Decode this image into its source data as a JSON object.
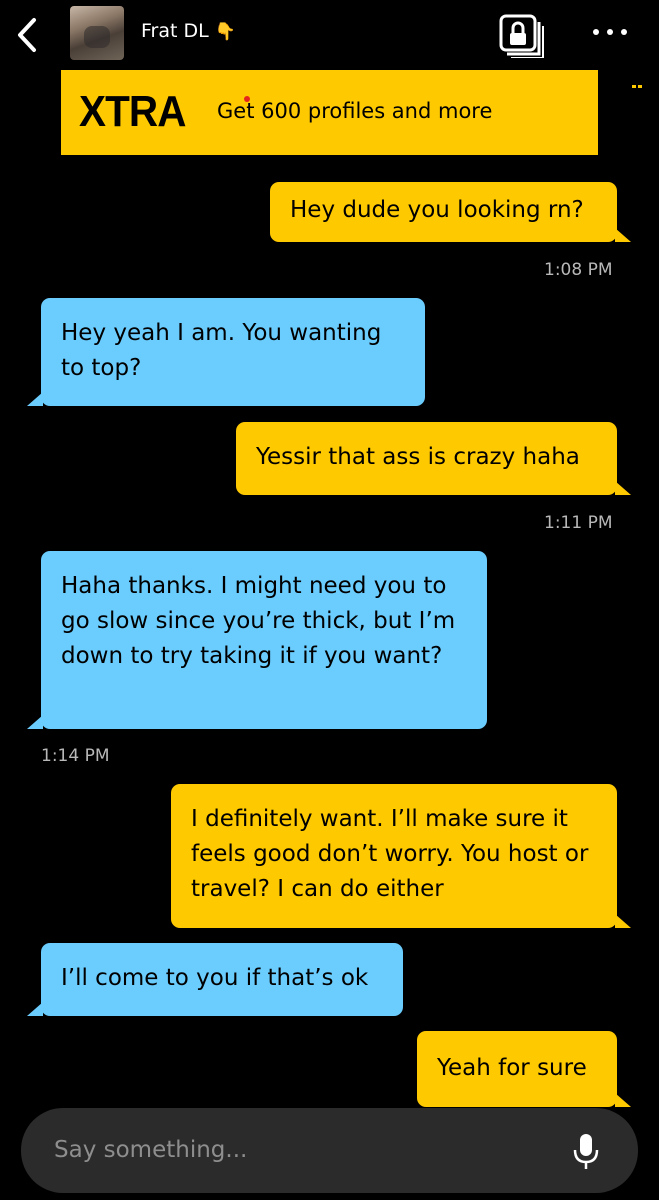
{
  "header": {
    "title": "Frat DL",
    "title_emoji": "👇",
    "icons": [
      "back-chevron-icon",
      "avatar",
      "album-lock-icon",
      "more-dots-icon"
    ]
  },
  "banner": {
    "logo": "XTRA",
    "text": "Get 600 profiles and more",
    "icon": "grindr-mask-icon",
    "color": "#ffc900"
  },
  "messages": [
    {
      "from": "me",
      "text": "Hey dude you looking rn?"
    },
    {
      "time": "1:08 PM"
    },
    {
      "from": "them",
      "text": "Hey yeah I am. You wanting to top?"
    },
    {
      "from": "me",
      "text": "Yessir that ass is crazy haha"
    },
    {
      "time": "1:11 PM"
    },
    {
      "from": "them",
      "text": "Haha thanks. I might need you to go slow since you’re thick, but I’m down to try taking it if you want?"
    },
    {
      "time": "1:14 PM"
    },
    {
      "from": "me",
      "text": "I definitely want. I’ll make sure it feels good don’t worry. You host or travel? I can do either"
    },
    {
      "from": "them",
      "text": "I’ll come to you if that’s ok"
    },
    {
      "from": "me",
      "text": "Yeah for sure"
    }
  ],
  "colors": {
    "outgoing": "#ffc900",
    "incoming": "#6bcdfe",
    "background": "#000000"
  },
  "composer": {
    "placeholder": "Say something...",
    "icon": "microphone-icon"
  }
}
